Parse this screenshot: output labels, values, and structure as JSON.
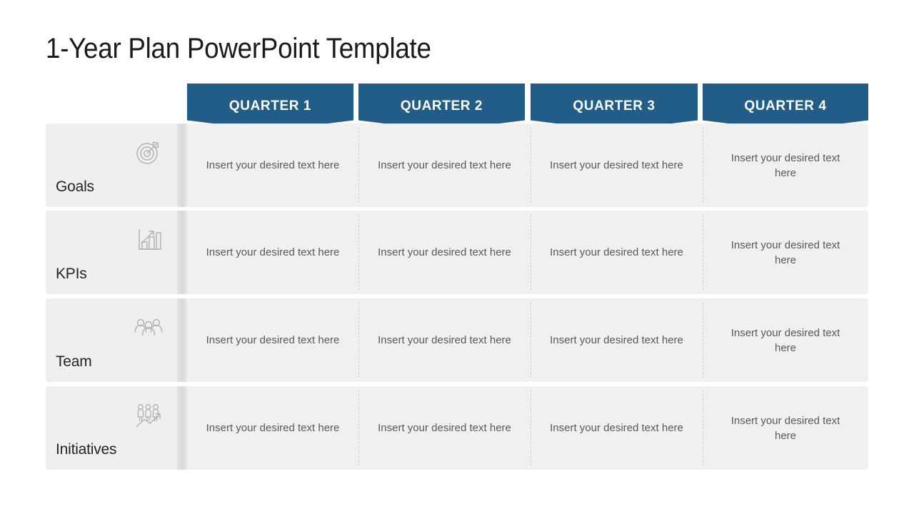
{
  "slide": {
    "title": "1-Year Plan PowerPoint Template",
    "accent_color": "#215D87",
    "row_background": "#F0F0F0",
    "body_text_color": "#595959"
  },
  "columns": [
    {
      "id": "q1",
      "label": "QUARTER 1"
    },
    {
      "id": "q2",
      "label": "QUARTER 2"
    },
    {
      "id": "q3",
      "label": "QUARTER 3"
    },
    {
      "id": "q4",
      "label": "QUARTER 4"
    }
  ],
  "rows": [
    {
      "label": "Goals",
      "icon": "target-arrow-icon",
      "cells": [
        "Insert your desired text here",
        "Insert your desired text here",
        "Insert your desired text here",
        "Insert your desired text here"
      ]
    },
    {
      "label": "KPIs",
      "icon": "bar-chart-growth-icon",
      "cells": [
        "Insert your desired text here",
        "Insert your desired text here",
        "Insert your desired text here",
        "Insert your desired text here"
      ]
    },
    {
      "label": "Team",
      "icon": "three-people-icon",
      "cells": [
        "Insert your desired text here",
        "Insert your desired text here",
        "Insert your desired text here",
        "Insert your desired text here"
      ]
    },
    {
      "label": "Initiatives",
      "icon": "people-growth-arrow-icon",
      "cells": [
        "Insert your desired text here",
        "Insert your desired text here",
        "Insert your desired text here",
        "Insert your desired text here"
      ]
    }
  ]
}
